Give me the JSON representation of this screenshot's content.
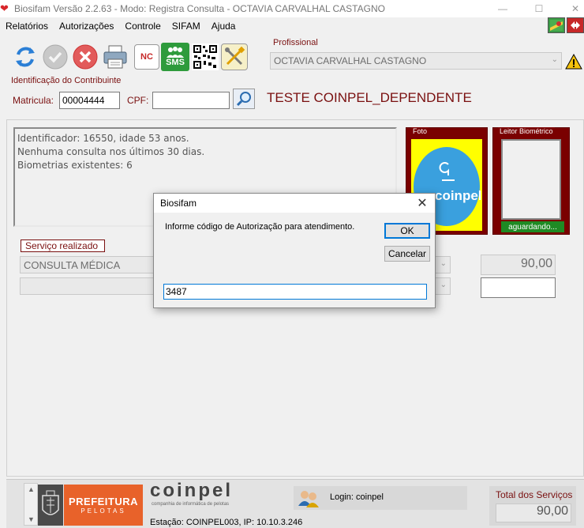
{
  "window": {
    "title": "Biosifam Versão 2.2.63 - Modo: Registra Consulta - OCTAVIA CARVALHAL CASTAGNO"
  },
  "menu": {
    "items": [
      "Relatórios",
      "Autorizações",
      "Controle",
      "SIFAM",
      "Ajuda"
    ]
  },
  "toolbar": {
    "nc_label": "NC",
    "sms_label": "SMS"
  },
  "profissional": {
    "legend": "Profissional",
    "value": "OCTAVIA CARVALHAL CASTAGNO"
  },
  "contribuinte": {
    "legend": "Identificação do Contribuinte",
    "matricula_label": "Matricula:",
    "matricula_value": "00004444",
    "cpf_label": "CPF:",
    "cpf_value": "",
    "name": "TESTE COINPEL_DEPENDENTE"
  },
  "info": {
    "lines": [
      "Identificador: 16550, idade 53 anos.",
      "Nenhuma consulta nos últimos 30 dias.",
      "Biometrias existentes: 6"
    ]
  },
  "foto": {
    "legend": "Foto",
    "logo_text": "coinpel"
  },
  "leitor": {
    "legend": "Leitor Biométrico",
    "status": "aguardando..."
  },
  "servico": {
    "legend": "Serviço realizado",
    "value": "CONSULTA MÉDICA",
    "price": "90,00",
    "second_value": "",
    "second_price": ""
  },
  "dialog": {
    "title": "Biosifam",
    "message": "Informe código de Autorização para atendimento.",
    "ok_label": "OK",
    "cancel_label": "Cancelar",
    "input_value": "3487"
  },
  "footer": {
    "prefeitura_line1": "PREFEITURA",
    "prefeitura_line2": "PELOTAS",
    "coinpel_name": "coinpel",
    "coinpel_tagline": "companhia de informática de pelotas",
    "estacao": "Estação: COINPEL003, IP: 10.10.3.246",
    "login": "Login: coinpel",
    "total_label": "Total dos Serviços",
    "total_value": "90,00"
  },
  "colors": {
    "accent_red": "#7a1010",
    "dialog_focus": "#0078d7",
    "prefeitura_orange": "#e8622a",
    "status_green": "#1f8a24"
  }
}
